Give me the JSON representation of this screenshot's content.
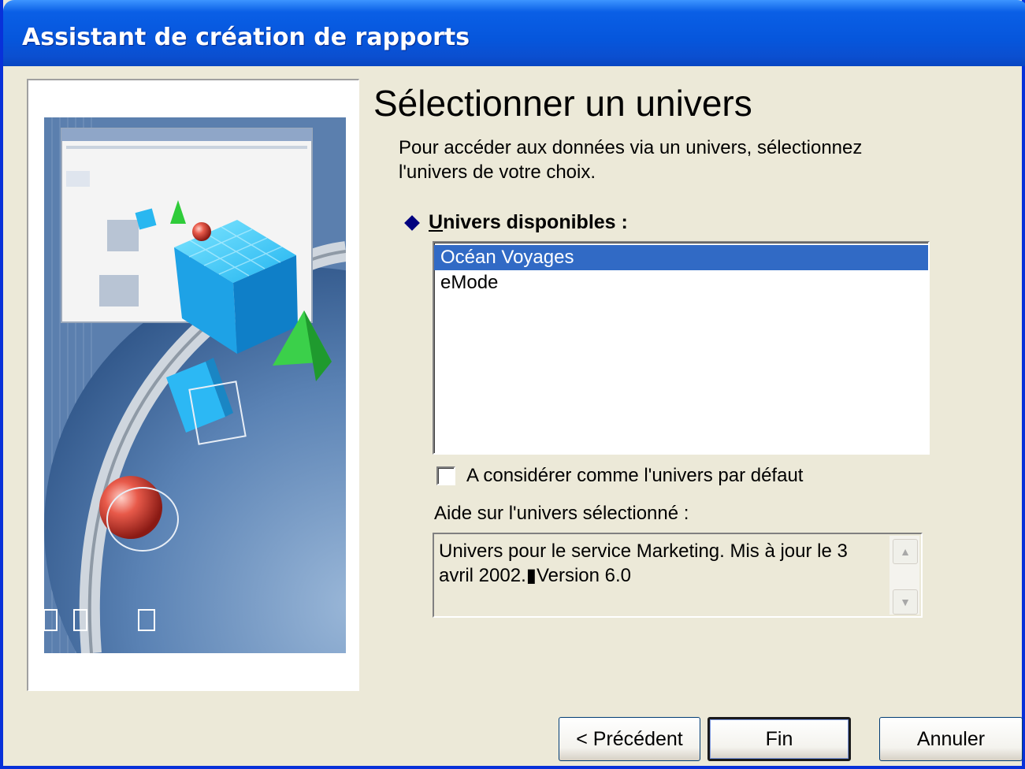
{
  "window": {
    "title": "Assistant de création de rapports"
  },
  "main": {
    "heading": "Sélectionner un univers",
    "intro_line1": "Pour accéder aux données via un univers, sélectionnez",
    "intro_line2": "l'univers de votre choix.",
    "list_label": "Univers disponibles :",
    "universes": [
      {
        "name": "Océan Voyages",
        "selected": true
      },
      {
        "name": "eMode",
        "selected": false
      }
    ],
    "default_checkbox_label": "A considérer comme l'univers par défaut",
    "default_checkbox_checked": false,
    "help_label": "Aide sur l'univers sélectionné :",
    "help_text_line1": "Univers pour le service Marketing. Mis à jour le 3",
    "help_text_line2": "avril 2002.▮Version 6.0"
  },
  "buttons": {
    "previous": "< Précédent",
    "finish": "Fin",
    "cancel": "Annuler"
  },
  "colors": {
    "titlebar": "#0a5fe6",
    "selection": "#316ac5",
    "dialog_bg": "#ece9d8",
    "diamond": "#00007f"
  },
  "icons": {
    "list_marker": "diamond-bullet-icon",
    "scroll_up": "scroll-up-arrow-icon",
    "scroll_down": "scroll-down-arrow-icon"
  }
}
